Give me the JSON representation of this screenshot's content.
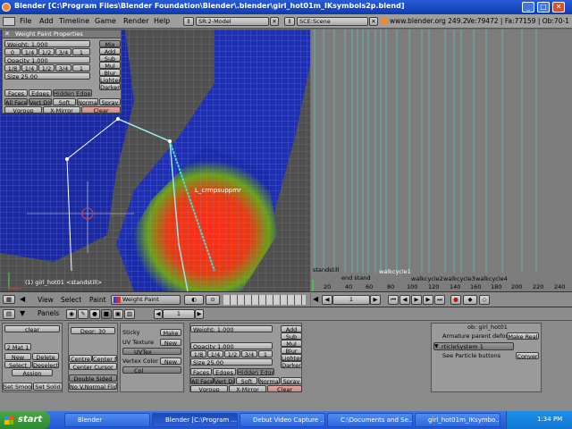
{
  "window": {
    "title": "Blender [C:\\Program Files\\Blender Foundation\\Blender\\.blender\\girl_hot01m_IKsymbols2p.blend]"
  },
  "menubar": {
    "items": [
      "File",
      "Add",
      "Timeline",
      "Game",
      "Render",
      "Help"
    ],
    "screen_select": "SR:2-Model",
    "scene_select": "SCE:Scene",
    "url": "www.blender.org 249.2",
    "stats": "Ve:79472 | Fa:77159 | Ob:70-1"
  },
  "weight_paint_panel": {
    "title": "Weight Paint Properties",
    "weight": "Weight: 1.000",
    "weight_presets": [
      "0",
      "1/4",
      "1/2",
      "3/4",
      "1"
    ],
    "opacity": "Opacity 1.000",
    "opacity_presets": [
      "1/8",
      "1/4",
      "1/2",
      "3/4",
      "1"
    ],
    "size": "Size 25.00",
    "modes": [
      "Mix",
      "Add",
      "Sub",
      "Mul",
      "Blur",
      "Lighter",
      "Darker"
    ],
    "tabs": [
      "Faces",
      "Edges",
      "Hidden Edges"
    ],
    "toggles": [
      "All Faces",
      "Vert Dist",
      "Soft",
      "Normals",
      "Spray"
    ],
    "vgroup": "Vgroup",
    "xmirror": "X-Mirror",
    "clear": "Clear"
  },
  "viewport": {
    "bone_label": "L_crmpsuppmr",
    "object_label": "(1) girl_hot01 <standstill>"
  },
  "timeline": {
    "markers": [
      "standstill",
      "end stand",
      "walkcycle1",
      "walkcycle2",
      "walkcycle3",
      "walkcycle4"
    ],
    "ticks": [
      "20",
      "40",
      "60",
      "80",
      "100",
      "120",
      "140",
      "160",
      "180",
      "200",
      "220",
      "240"
    ],
    "current_frame": "1"
  },
  "viewport_header": {
    "menus": [
      "View",
      "Select",
      "Paint"
    ],
    "mode": "Weight Paint"
  },
  "buttons_header": {
    "panels_label": "Panels",
    "frame": "1"
  },
  "buttons_window": {
    "link_panel": {
      "clear": "clear",
      "mat": "2 Mat 1",
      "new": "New",
      "delete": "Delete",
      "select": "Select",
      "deselect": "Deselect",
      "assign": "Assign",
      "set_smooth": "Set Smoo",
      "set_solid": "Set Solid"
    },
    "mesh_panel": {
      "degr": "Degr: 30",
      "centre": "Centre",
      "centre_new": "Center Ne",
      "center_cursor": "Center Cursor",
      "double_sided": "Double Sided",
      "no_vnormal_flip": "No V.Normal Flip"
    },
    "uv_panel": {
      "sticky": "Sticky",
      "make": "Make",
      "uv_texture": "UV Texture",
      "new": "New",
      "uvtex": "UVTex",
      "vertex_color": "Vertex Color",
      "col": "Col"
    },
    "paint_panel": {
      "weight": "Weight: 1.000",
      "opacity": "Opacity 1.000",
      "size": "Size 25.00",
      "modes": [
        "Add",
        "Sub",
        "Mul",
        "Blur",
        "Lighter",
        "Darker"
      ],
      "tabs": [
        "Faces",
        "Edges",
        "Hidden Edge"
      ],
      "toggles": [
        "All Face",
        "Vert Dis",
        "Soft",
        "Normals",
        "Spray"
      ],
      "vgroup": "Vgroup",
      "xmirror": "X-Mirror",
      "clear": "Clear"
    },
    "modifier_panel": {
      "armature_deform": "Armature parent deform",
      "make_real": "Make Real",
      "particle_system": "rticleSystem 1",
      "see_particle": "See Particle buttons",
      "convert": "Conver",
      "ob_label": "ob: girl_hot01"
    }
  },
  "taskbar": {
    "start": "start",
    "tasks": [
      "Blender",
      "Blender [C:\\Program ...",
      "Debut Video Capture ...",
      "C:\\Documents and Se...",
      "girl_hot01m_IKsymbo..."
    ],
    "clock": "1:34 PM"
  }
}
